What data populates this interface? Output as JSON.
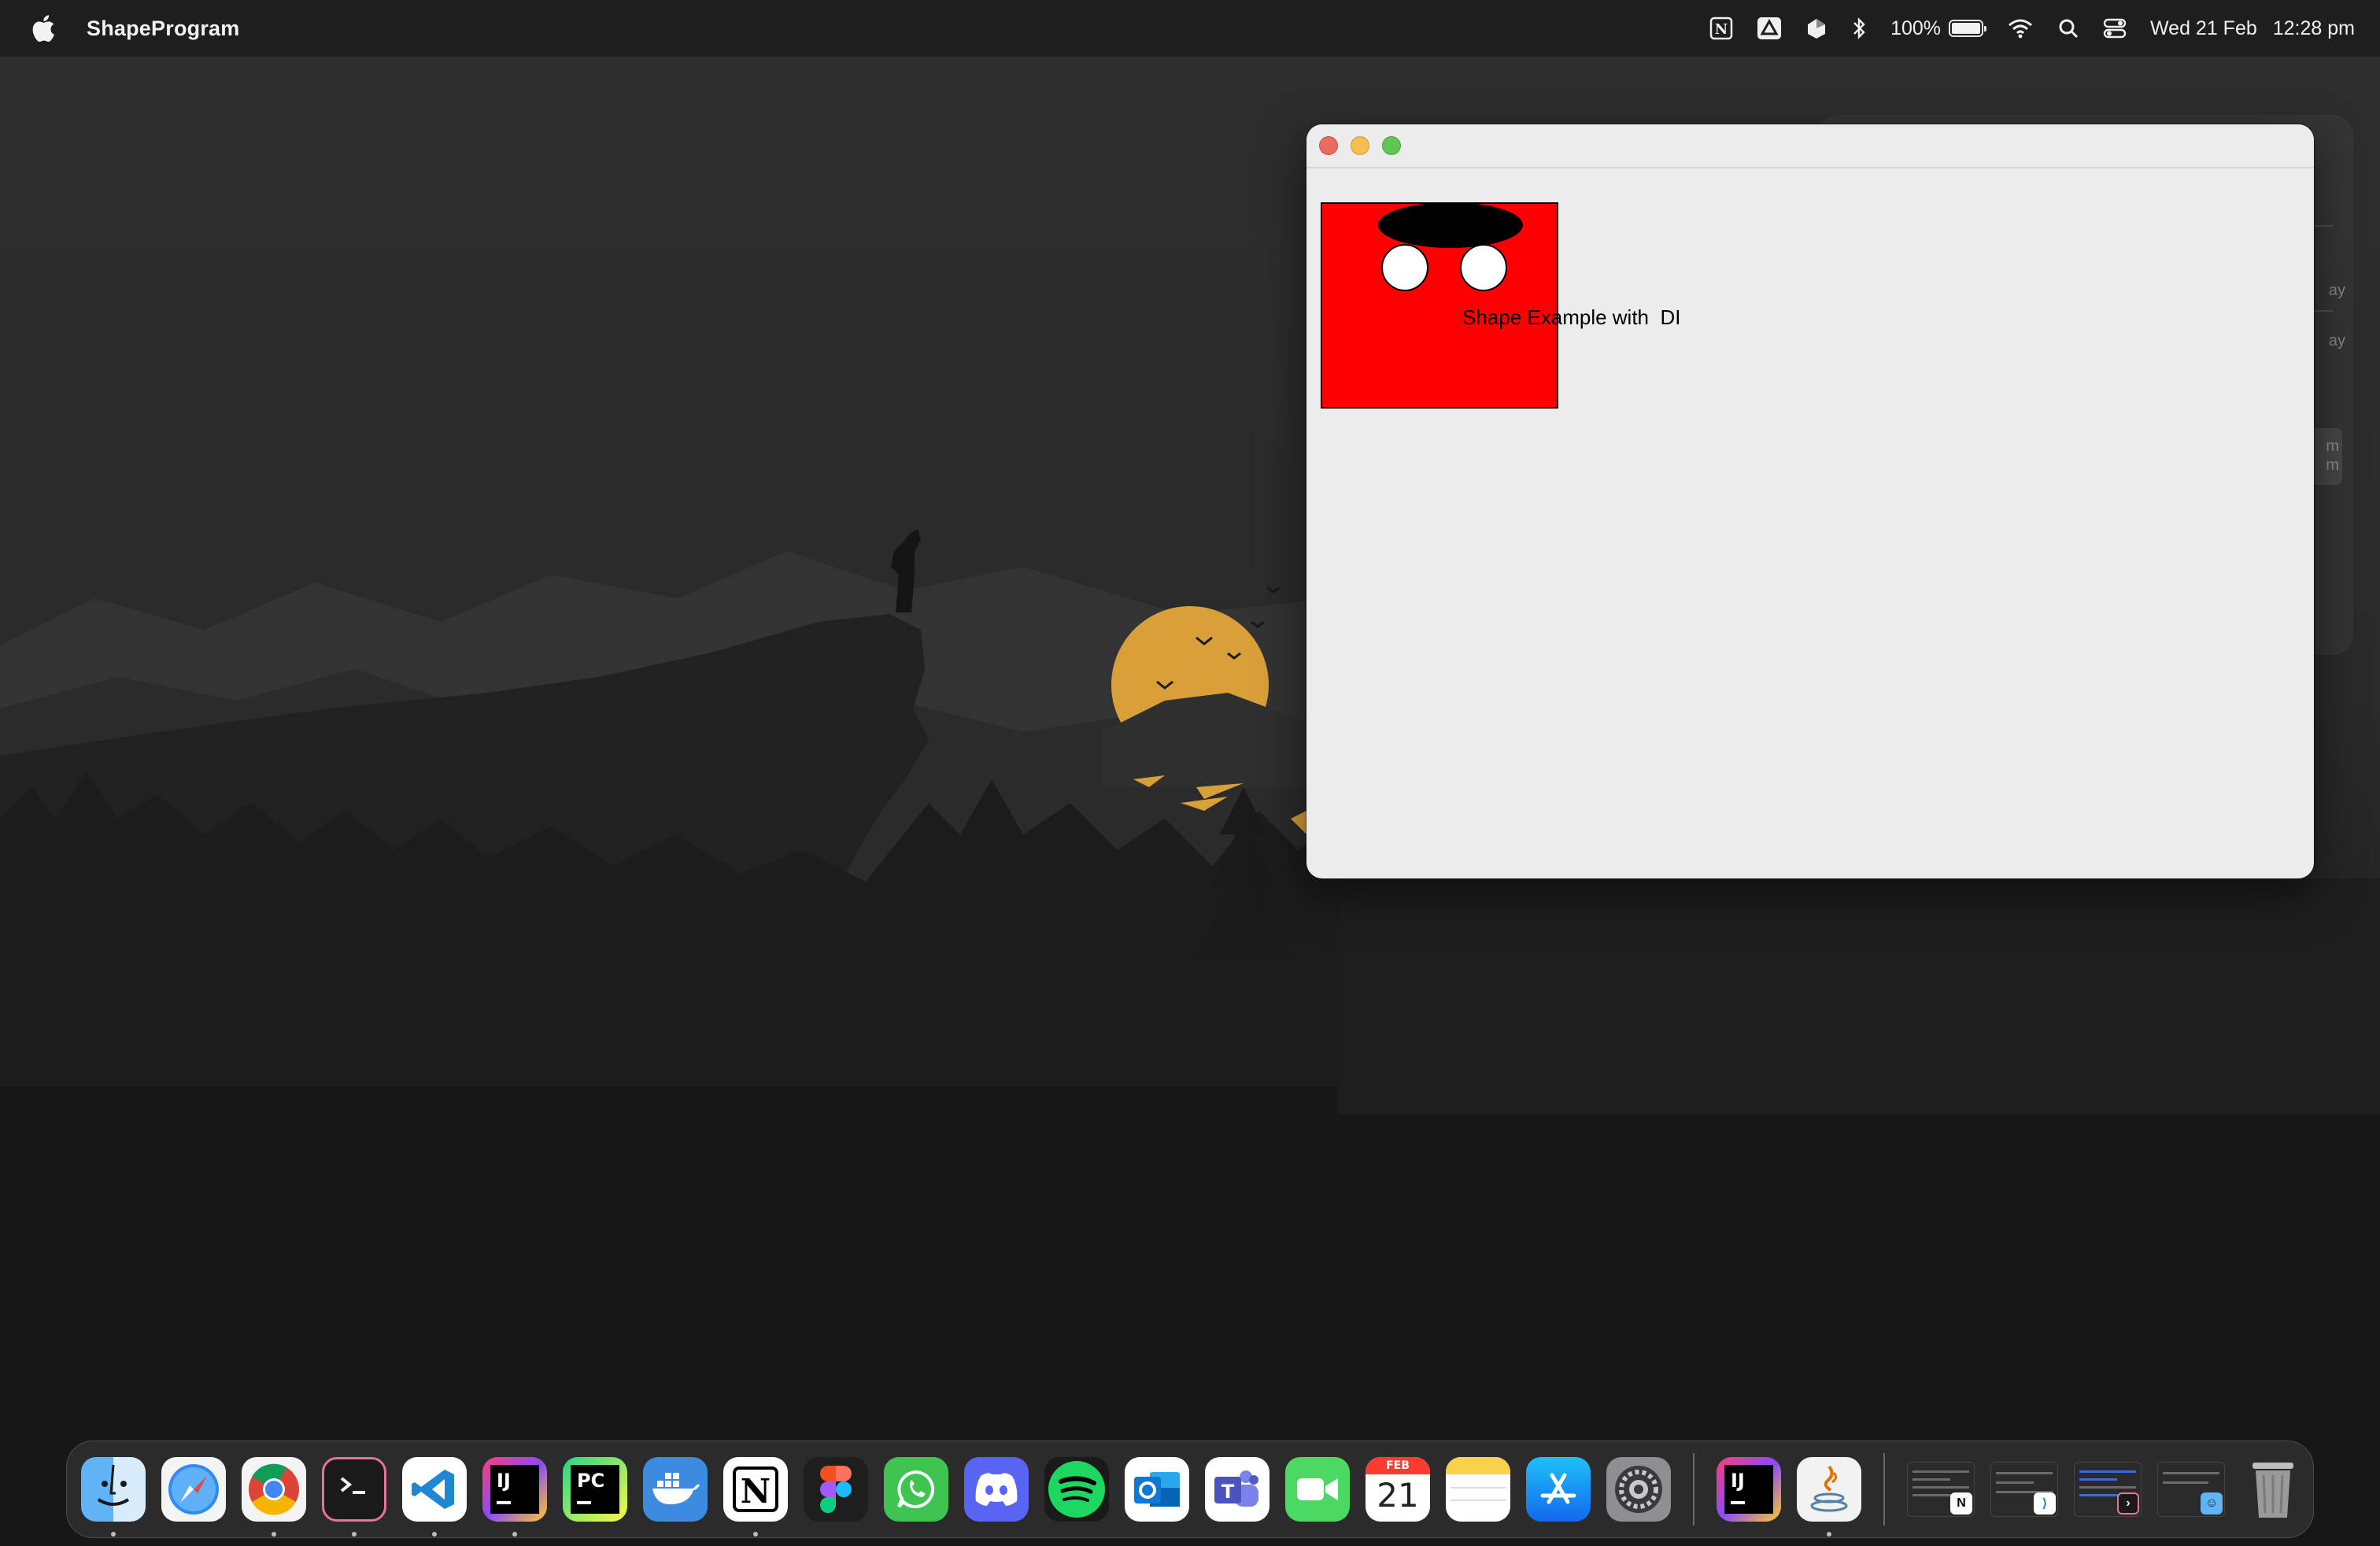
{
  "menubar": {
    "app_name": "ShapeProgram",
    "status_icons": [
      "notion-icon",
      "google-drive-icon",
      "craft-icon",
      "bluetooth-icon"
    ],
    "battery_percent": "100%",
    "battery_level": 1.0,
    "date": "Wed 21 Feb",
    "time": "12:28 pm"
  },
  "window": {
    "title": "",
    "canvas": {
      "label": "Shape Example with  DI",
      "background_color": "#ff0000",
      "mouth_color": "#000000",
      "eye_color": "#ffffff"
    }
  },
  "ghost_window": {
    "texts": [
      "ay",
      "ay",
      "m",
      "m"
    ]
  },
  "dock": {
    "apps": [
      {
        "name": "Finder",
        "icon": "finder-icon",
        "running": true
      },
      {
        "name": "Safari",
        "icon": "safari-icon",
        "running": false
      },
      {
        "name": "Google Chrome",
        "icon": "chrome-icon",
        "running": true
      },
      {
        "name": "Warp",
        "icon": "terminal-icon",
        "running": true
      },
      {
        "name": "Visual Studio Code",
        "icon": "vscode-icon",
        "running": true
      },
      {
        "name": "IntelliJ IDEA",
        "icon": "intellij-icon",
        "running": true
      },
      {
        "name": "PyCharm",
        "icon": "pycharm-icon",
        "running": false
      },
      {
        "name": "Docker",
        "icon": "docker-icon",
        "running": false
      },
      {
        "name": "Notion",
        "icon": "notion-icon",
        "running": true
      },
      {
        "name": "Figma",
        "icon": "figma-icon",
        "running": false
      },
      {
        "name": "WhatsApp",
        "icon": "whatsapp-icon",
        "running": false
      },
      {
        "name": "Discord",
        "icon": "discord-icon",
        "running": false
      },
      {
        "name": "Spotify",
        "icon": "spotify-icon",
        "running": false
      },
      {
        "name": "Outlook",
        "icon": "outlook-icon",
        "running": false
      },
      {
        "name": "Teams",
        "icon": "teams-icon",
        "running": false
      },
      {
        "name": "FaceTime",
        "icon": "facetime-icon",
        "running": false
      },
      {
        "name": "Calendar",
        "icon": "calendar-icon",
        "running": false,
        "month": "FEB",
        "day": "21"
      },
      {
        "name": "Notes",
        "icon": "notes-icon",
        "running": false
      },
      {
        "name": "App Store",
        "icon": "app-store-icon",
        "running": false
      },
      {
        "name": "System Settings",
        "icon": "settings-icon",
        "running": false
      }
    ],
    "recent_apps": [
      {
        "name": "IntelliJ IDEA",
        "icon": "intellij-icon",
        "running": false
      },
      {
        "name": "Java",
        "icon": "java-icon",
        "running": true
      }
    ],
    "minimized_windows": [
      "notion-window-thumbnail",
      "vscode-window-thumbnail",
      "terminal-window-thumbnail",
      "finder-window-thumbnail"
    ],
    "trash": {
      "name": "Trash",
      "icon": "trash-icon"
    }
  }
}
